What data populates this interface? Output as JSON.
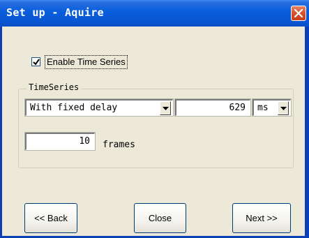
{
  "window": {
    "title": "Set up - Aquire"
  },
  "enable_time_series": {
    "label": "Enable Time Series",
    "checked": true
  },
  "time_series": {
    "group_label": "TimeSeries",
    "mode": "With fixed delay",
    "delay_value": "629",
    "delay_unit": "ms",
    "frames_value": "10",
    "frames_label": "frames"
  },
  "buttons": {
    "back": "<< Back",
    "close": "Close",
    "next": "Next >>"
  },
  "icons": {
    "close": "close-x-icon",
    "check": "checkmark-icon",
    "dropdown": "chevron-down-icon"
  }
}
